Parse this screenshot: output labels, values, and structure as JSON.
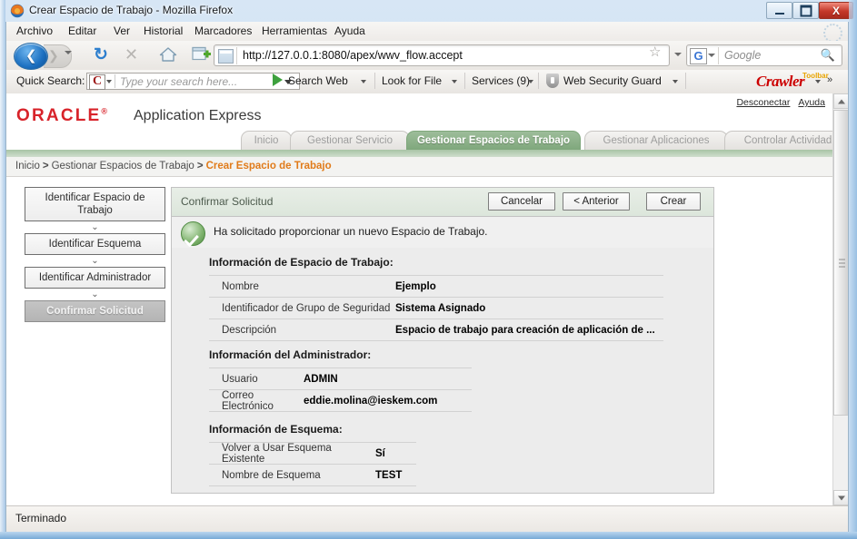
{
  "window": {
    "title": "Crear Espacio de Trabajo - Mozilla Firefox",
    "minimize_label": "",
    "maximize_label": "",
    "close_label": "X"
  },
  "menubar": [
    {
      "label": "Archivo",
      "accel": "A"
    },
    {
      "label": "Editar",
      "accel": "E"
    },
    {
      "label": "Ver",
      "accel": "V"
    },
    {
      "label": "Historial",
      "accel": "s"
    },
    {
      "label": "Marcadores",
      "accel": "M"
    },
    {
      "label": "Herramientas",
      "accel": "n"
    },
    {
      "label": "Ayuda",
      "accel": "u"
    }
  ],
  "navbar": {
    "url": "http://127.0.0.1:8080/apex/wwv_flow.accept",
    "search_engine": "G",
    "search_placeholder": "Google"
  },
  "crawler_toolbar": {
    "quick_search_label": "Quick Search:",
    "quick_search_placeholder": "Type your search here...",
    "items": [
      {
        "label": "Search Web"
      },
      {
        "label": "Look for File"
      },
      {
        "label": "Services (9)"
      },
      {
        "label": "Web Security Guard"
      }
    ],
    "brand": "Crawler",
    "brand_sub": "Toolbar",
    "overflow": "»"
  },
  "apex": {
    "logo": "ORACLE",
    "logo_reg": "®",
    "product": "Application Express",
    "header_links": [
      {
        "label": "Desconectar"
      },
      {
        "label": "Ayuda"
      }
    ],
    "tabs": [
      {
        "label": "Inicio",
        "active": false
      },
      {
        "label": "Gestionar Servicio",
        "active": false
      },
      {
        "label": "Gestionar Espacios de Trabajo",
        "active": true
      },
      {
        "label": "Gestionar Aplicaciones",
        "active": false
      },
      {
        "label": "Controlar Actividad",
        "active": false
      }
    ],
    "breadcrumb": [
      {
        "label": "Inicio",
        "current": false
      },
      {
        "label": "Gestionar Espacios de Trabajo",
        "current": false
      },
      {
        "label": "Crear Espacio de Trabajo",
        "current": true
      }
    ],
    "breadcrumb_separator": ">"
  },
  "wizard": {
    "steps": [
      {
        "label": "Identificar Espacio de Trabajo",
        "current": false
      },
      {
        "label": "Identificar Esquema",
        "current": false
      },
      {
        "label": "Identificar Administrador",
        "current": false
      },
      {
        "label": "Confirmar Solicitud",
        "current": true
      }
    ],
    "arrow": "⌄"
  },
  "panel": {
    "title": "Confirmar Solicitud",
    "buttons": {
      "cancel": "Cancelar",
      "previous": "< Anterior",
      "create": "Crear"
    },
    "message": "Ha solicitado proporcionar un nuevo Espacio de Trabajo.",
    "sections": [
      {
        "heading": "Información de Espacio de Trabajo:",
        "rows": [
          {
            "label": "Nombre",
            "value": "Ejemplo"
          },
          {
            "label": "Identificador de Grupo de Seguridad",
            "value": "Sistema Asignado"
          },
          {
            "label": "Descripción",
            "value": "Espacio de trabajo para creación de aplicación de ..."
          }
        ]
      },
      {
        "heading": "Información del Administrador:",
        "rows": [
          {
            "label": "Usuario",
            "value": "ADMIN"
          },
          {
            "label": "Correo Electrónico",
            "value": "eddie.molina@ieskem.com"
          }
        ]
      },
      {
        "heading": "Información de Esquema:",
        "rows": [
          {
            "label": "Volver a Usar Esquema Existente",
            "value": "Sí"
          },
          {
            "label": "Nombre de Esquema",
            "value": "TEST"
          }
        ]
      }
    ]
  },
  "statusbar": {
    "text": "Terminado"
  },
  "colors": {
    "oracle_red": "#d8232a",
    "tab_active": "#7fa77c",
    "breadcrumb_current": "#e07b1a",
    "success_green": "#4f8a42"
  }
}
